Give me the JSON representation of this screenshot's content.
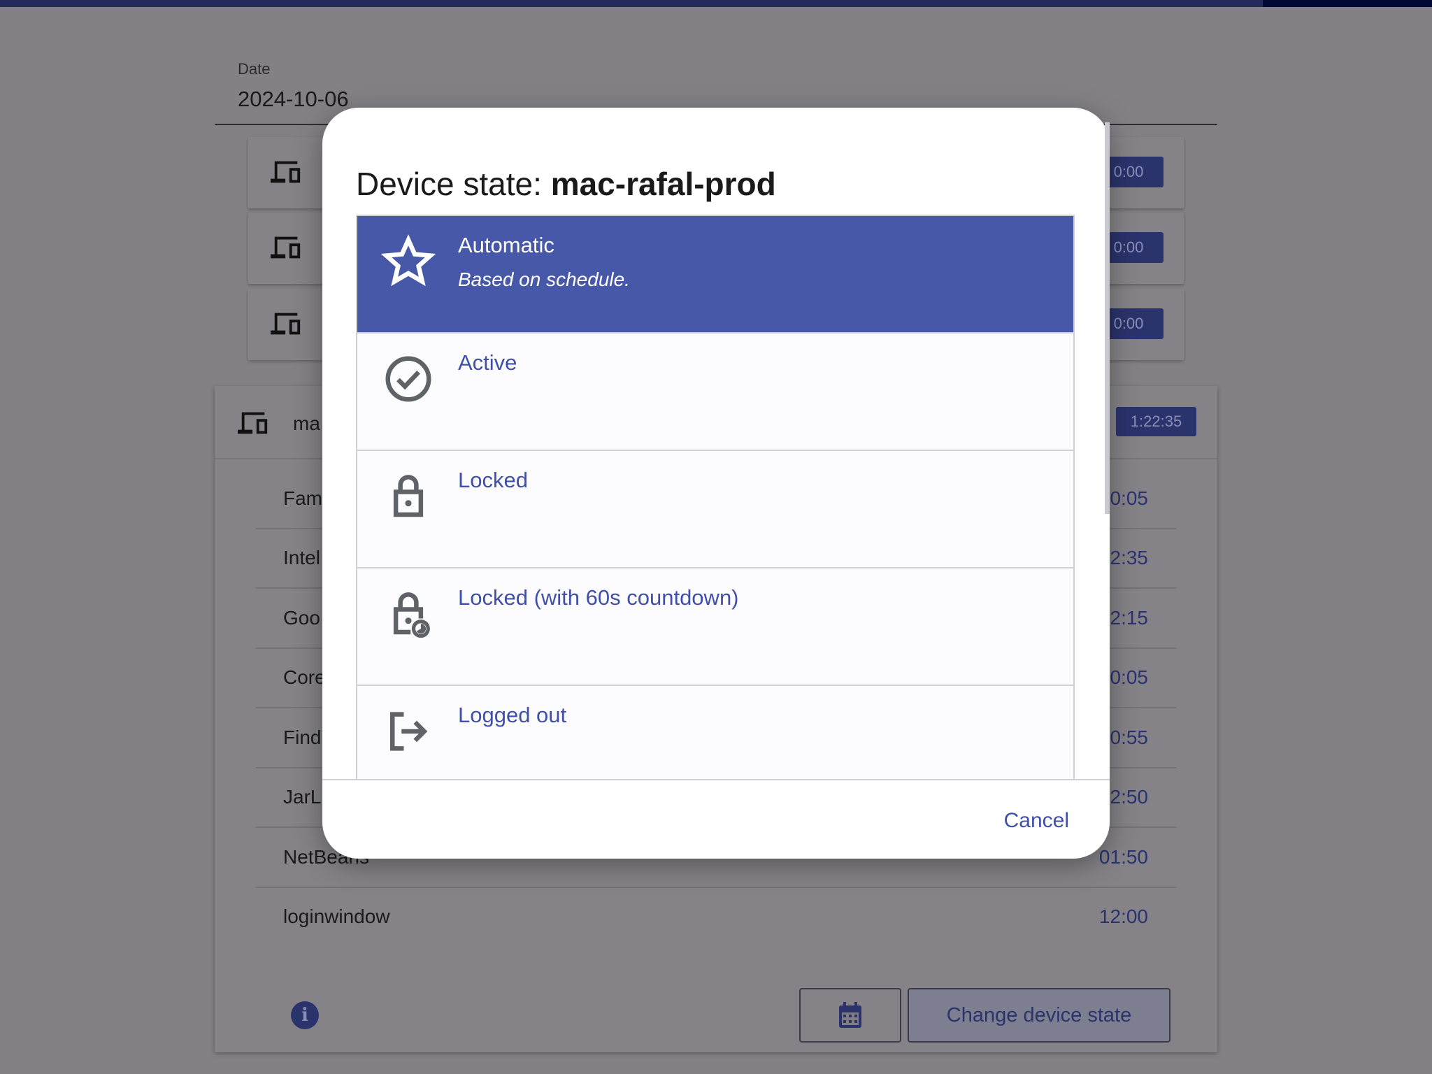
{
  "date": {
    "label": "Date",
    "value": "2024-10-06"
  },
  "cards": [
    {
      "badge": "0:00"
    },
    {
      "badge": "0:00"
    },
    {
      "badge": "0:00"
    }
  ],
  "device_panel": {
    "name": "ma",
    "badge": "1:22:35",
    "rows": [
      {
        "name": "Fam",
        "time": "0:05"
      },
      {
        "name": "Intel",
        "time": "2:35"
      },
      {
        "name": "Goo",
        "time": "2:15"
      },
      {
        "name": "Core",
        "time": "0:05"
      },
      {
        "name": "Find",
        "time": "0:55"
      },
      {
        "name": "JarL",
        "time": "2:50"
      },
      {
        "name": "NetBeans",
        "time": "01:50"
      },
      {
        "name": "loginwindow",
        "time": "12:00"
      }
    ],
    "change_state_label": "Change device state"
  },
  "dialog": {
    "title_prefix": "Device state: ",
    "device_name": "mac-rafal-prod",
    "options": [
      {
        "label": "Automatic",
        "subtitle": "Based on schedule.",
        "icon": "star-icon",
        "selected": true
      },
      {
        "label": "Active",
        "icon": "check-circle-icon"
      },
      {
        "label": "Locked",
        "icon": "lock-icon"
      },
      {
        "label": "Locked (with 60s countdown)",
        "icon": "lock-clock-icon"
      },
      {
        "label": "Logged out",
        "icon": "logout-icon"
      }
    ],
    "cancel_label": "Cancel"
  },
  "colors": {
    "primary": "#4858a8",
    "link": "#4050a8",
    "topbar": "#232a5a"
  }
}
